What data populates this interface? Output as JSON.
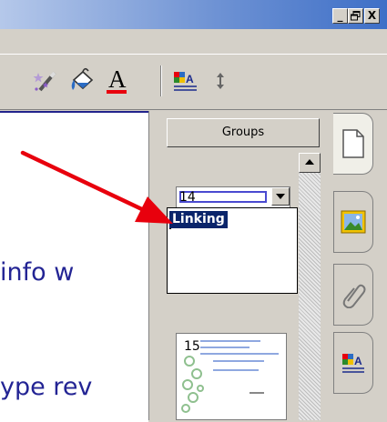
{
  "window": {
    "min_label": "_",
    "max_label": "¸",
    "close_label": "X"
  },
  "toolbar": {
    "icons": [
      "magic-wand-icon",
      "paint-bucket-icon",
      "font-color-icon",
      "text-format-icon",
      "line-spacing-icon"
    ],
    "font_color_label": "A",
    "accent_red": "#e8000d"
  },
  "canvas": {
    "text_line1": "info w",
    "text_line2": "ype rev",
    "text_color": "#232494"
  },
  "page_sorter": {
    "groups_label": "Groups",
    "page_number_top": "14",
    "page_number_bottom": "15",
    "dropdown_items": [
      "Linking"
    ],
    "selected_item": "Linking",
    "selection_color": "#0a246a"
  },
  "side_tabs": [
    "page-sorter-icon",
    "gallery-icon",
    "attachments-icon",
    "properties-icon"
  ],
  "annotation": {
    "arrow_color": "#e8000d"
  }
}
